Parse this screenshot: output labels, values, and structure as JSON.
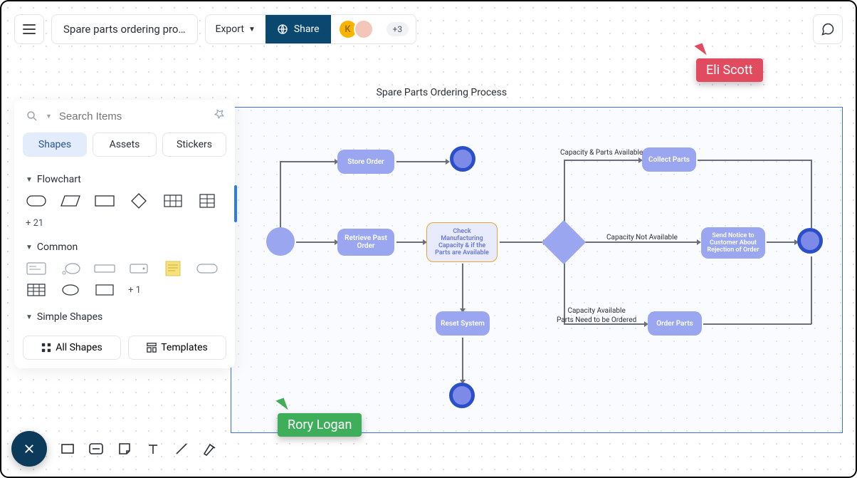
{
  "header": {
    "doc_title": "Spare parts ordering pro…",
    "export_label": "Export",
    "share_label": "Share",
    "avatar_letter": "K",
    "more_count": "+3"
  },
  "diagram": {
    "title": "Spare Parts Ordering Process",
    "nodes": {
      "store_order": "Store Order",
      "retrieve": "Retrieve Past Order",
      "check": "Check Manufacturing Capacity & if the Parts are Available",
      "reset": "Reset System",
      "collect": "Collect Parts",
      "notice": "Send Notice to Customer About Rejection of Order",
      "order_parts": "Order Parts"
    },
    "labels": {
      "cap_parts_avail": "Capacity & Parts Available",
      "cap_not_avail": "Capacity Not Available",
      "cap_avail_order": "Capacity Available\nParts Need to be Ordered"
    }
  },
  "panel": {
    "search_placeholder": "Search Items",
    "tabs": {
      "shapes": "Shapes",
      "assets": "Assets",
      "stickers": "Stickers"
    },
    "sections": {
      "flowchart": "Flowchart",
      "flowchart_more": "+ 21",
      "common": "Common",
      "common_more": "+ 1",
      "simple": "Simple Shapes"
    },
    "buttons": {
      "all_shapes": "All Shapes",
      "templates": "Templates"
    }
  },
  "collaborators": {
    "eli": "Eli Scott",
    "rory": "Rory Logan"
  }
}
